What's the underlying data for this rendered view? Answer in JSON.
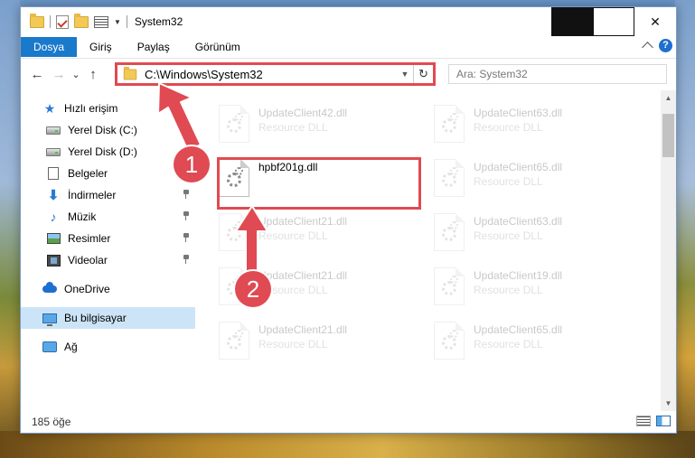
{
  "window": {
    "title": "System32",
    "controls": {
      "minimize": "—",
      "maximize": "□",
      "close": "✕"
    }
  },
  "ribbon": {
    "tabs": [
      {
        "label": "Dosya",
        "active": true
      },
      {
        "label": "Giriş"
      },
      {
        "label": "Paylaş"
      },
      {
        "label": "Görünüm"
      }
    ],
    "help": "?"
  },
  "address": {
    "path": "C:\\Windows\\System32",
    "refresh_icon": "↻",
    "search_placeholder": "Ara: System32"
  },
  "nav": {
    "back": "←",
    "forward": "→",
    "recent": "⌄",
    "up": "↑"
  },
  "sidebar": {
    "quick_access": "Hızlı erişim",
    "items": [
      {
        "label": "Yerel Disk (C:)",
        "icon": "drive-icon",
        "pinned": true
      },
      {
        "label": "Yerel Disk (D:)",
        "icon": "drive-icon",
        "pinned": false
      },
      {
        "label": "Belgeler",
        "icon": "documents-icon",
        "pinned": true
      },
      {
        "label": "İndirmeler",
        "icon": "downloads-icon",
        "pinned": true
      },
      {
        "label": "Müzik",
        "icon": "music-icon",
        "pinned": true
      },
      {
        "label": "Resimler",
        "icon": "pictures-icon",
        "pinned": true
      },
      {
        "label": "Videolar",
        "icon": "videos-icon",
        "pinned": true
      }
    ],
    "onedrive": "OneDrive",
    "this_pc": "Bu bilgisayar",
    "network": "Ağ"
  },
  "files": {
    "col1": [
      {
        "name": "UpdateClient42.dll",
        "type": "Resource DLL"
      },
      {
        "name": "hpbf201g.dll",
        "type": ""
      },
      {
        "name": "UpdateClient21.dll",
        "type": "Resource DLL"
      },
      {
        "name": "UpdateClient21.dll",
        "type": "Resource DLL"
      },
      {
        "name": "UpdateClient21.dll",
        "type": "Resource DLL"
      }
    ],
    "col2": [
      {
        "name": "UpdateClient63.dll",
        "type": "Resource DLL"
      },
      {
        "name": "UpdateClient65.dll",
        "type": "Resource DLL"
      },
      {
        "name": "UpdateClient63.dll",
        "type": "Resource DLL"
      },
      {
        "name": "UpdateClient19.dll",
        "type": "Resource DLL"
      },
      {
        "name": "UpdateClient65.dll",
        "type": "Resource DLL"
      }
    ]
  },
  "status": {
    "item_count": "185 öğe"
  },
  "annotations": {
    "marker1": "1",
    "marker2": "2",
    "color": "#e04a52"
  }
}
